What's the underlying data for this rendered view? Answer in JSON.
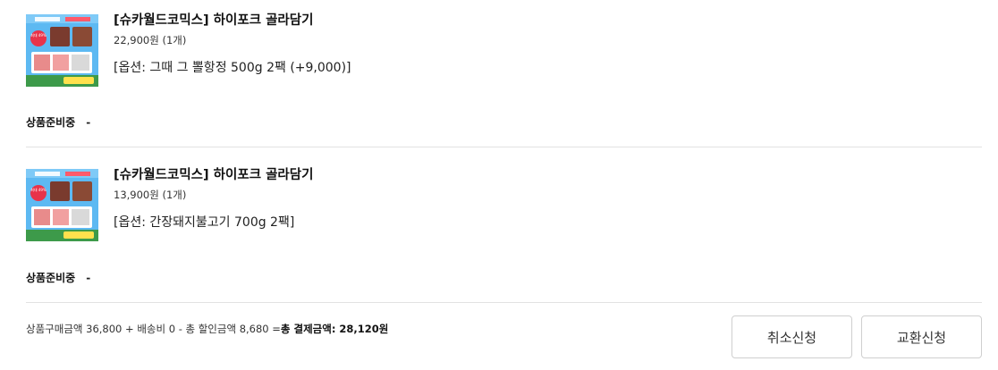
{
  "orders": [
    {
      "product_name": "[슈카월드코믹스] 하이포크 골라담기",
      "price": "22,900원 (1개)",
      "option": "[옵션: 그때 그 뽈항정 500g 2팩 (+9,000)]",
      "status_label": "상품준비중",
      "status_value": "-",
      "thumb_badge": "최대 49%"
    },
    {
      "product_name": "[슈카월드코믹스] 하이포크 골라담기",
      "price": "13,900원 (1개)",
      "option": "[옵션: 간장돼지불고기 700g 2팩]",
      "status_label": "상품준비중",
      "status_value": "-",
      "thumb_badge": "최대 49%"
    }
  ],
  "summary": {
    "prefix": "상품구매금액 36,800 + 배송비 0 - 총 할인금액 8,680 =",
    "total_label": "총 결제금액",
    "total_value": ": 28,120원"
  },
  "buttons": {
    "cancel": "취소신청",
    "exchange": "교환신청"
  },
  "colors": {
    "thumb_background": "#5db9f2",
    "badge": "#e8334a",
    "divider": "#e2e2e2"
  }
}
